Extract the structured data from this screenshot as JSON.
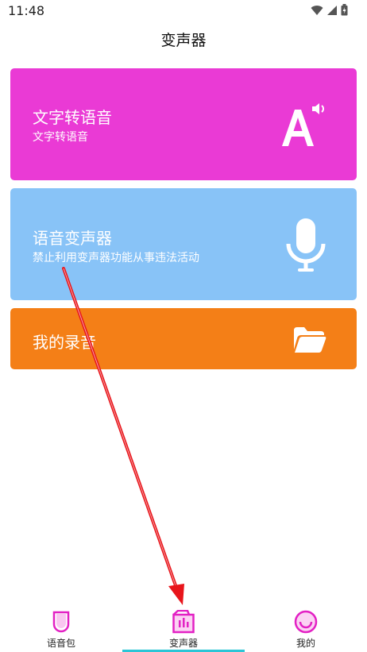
{
  "status_bar": {
    "time": "11:48",
    "icons": [
      "wifi-icon",
      "signal-icon",
      "battery-icon"
    ]
  },
  "header": {
    "title": "变声器"
  },
  "cards": {
    "tts": {
      "title": "文字转语音",
      "subtitle": "文字转语音",
      "icon": "text-speaker-icon",
      "color": "#ea3ad5"
    },
    "changer": {
      "title": "语音变声器",
      "subtitle": "禁止利用变声器功能从事违法活动",
      "icon": "microphone-icon",
      "color": "#88c3f7"
    },
    "recordings": {
      "title": "我的录音",
      "icon": "folder-icon",
      "color": "#f47f17"
    }
  },
  "bottom_nav": {
    "items": [
      {
        "label": "语音包",
        "icon": "voice-pack-icon"
      },
      {
        "label": "变声器",
        "icon": "voice-changer-icon",
        "active": true
      },
      {
        "label": "我的",
        "icon": "profile-icon"
      }
    ],
    "accent": "#e321c4",
    "indicator_color": "#2bc5d6"
  },
  "annotation": {
    "arrow_color": "#e8151b"
  }
}
